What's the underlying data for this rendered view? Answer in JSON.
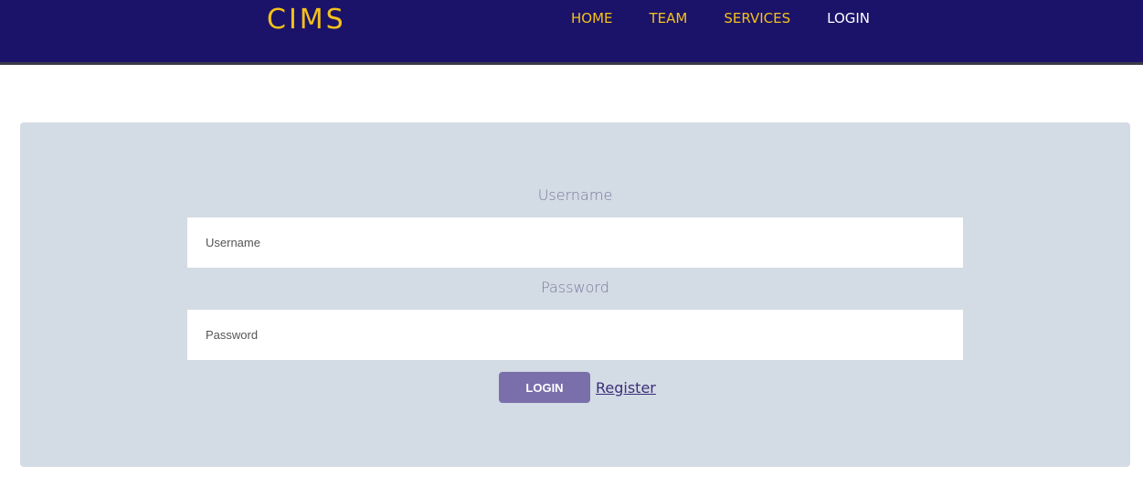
{
  "brand": {
    "name": "CIMS"
  },
  "nav": {
    "items": [
      {
        "label": "HOME",
        "active": false
      },
      {
        "label": "TEAM",
        "active": false
      },
      {
        "label": "SERVICES",
        "active": false
      },
      {
        "label": "LOGIN",
        "active": true
      }
    ]
  },
  "form": {
    "username_label": "Username",
    "username_placeholder": "Username",
    "password_label": "Password",
    "password_placeholder": "Password",
    "login_button": "LOGIN",
    "register_link": "Register"
  },
  "colors": {
    "navbar_bg": "#1b1369",
    "brand_accent": "#f5c11a",
    "card_bg": "#d3dbe4",
    "button_bg": "#7a6fab"
  }
}
